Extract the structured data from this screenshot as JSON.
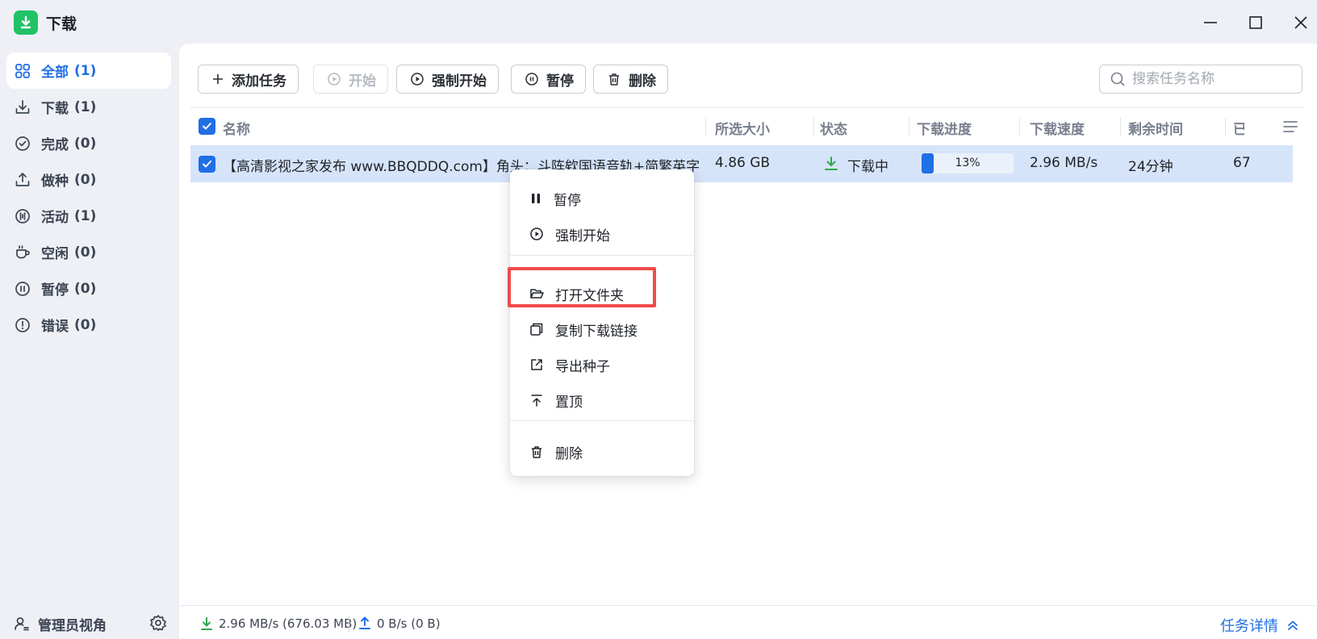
{
  "app": {
    "title": "下载"
  },
  "sidebar": {
    "items": [
      {
        "label": "全部",
        "count": "(1)",
        "icon": "grid-icon",
        "active": true
      },
      {
        "label": "下载",
        "count": "(1)",
        "icon": "download-icon"
      },
      {
        "label": "完成",
        "count": "(0)",
        "icon": "check-circle-icon"
      },
      {
        "label": "做种",
        "count": "(0)",
        "icon": "upload-icon"
      },
      {
        "label": "活动",
        "count": "(1)",
        "icon": "activity-icon"
      },
      {
        "label": "空闲",
        "count": "(0)",
        "icon": "cup-icon"
      },
      {
        "label": "暂停",
        "count": "(0)",
        "icon": "pause-circle-icon"
      },
      {
        "label": "错误",
        "count": "(0)",
        "icon": "error-circle-icon"
      }
    ],
    "admin_label": "管理员视角"
  },
  "toolbar": {
    "add": "添加任务",
    "start": "开始",
    "force_start": "强制开始",
    "pause": "暂停",
    "delete": "删除",
    "search_placeholder": "搜索任务名称"
  },
  "table": {
    "columns": [
      "名称",
      "所选大小",
      "状态",
      "下载进度",
      "下载速度",
      "剩余时间",
      "已"
    ],
    "rows": [
      {
        "name": "【高清影视之家发布 www.BBQDDQ.com】角头：斗阵欸国语音轨+简繁英字...",
        "size": "4.86 GB",
        "status": "下载中",
        "progress_percent": 13,
        "progress_label": "13%",
        "speed": "2.96 MB/s",
        "remaining": "24分钟",
        "downloaded": "67"
      }
    ]
  },
  "context_menu": {
    "pause": "暂停",
    "force_start": "强制开始",
    "open_folder": "打开文件夹",
    "copy_link": "复制下载链接",
    "export_torrent": "导出种子",
    "pin_top": "置顶",
    "delete": "删除"
  },
  "statusbar": {
    "download": "2.96 MB/s (676.03 MB)",
    "upload": "0 B/s (0 B)",
    "details": "任务详情"
  },
  "colors": {
    "accent": "#1f6fe5",
    "app_green": "#21c266",
    "highlight": "#f04a4a",
    "download_green": "#2fa84f"
  }
}
